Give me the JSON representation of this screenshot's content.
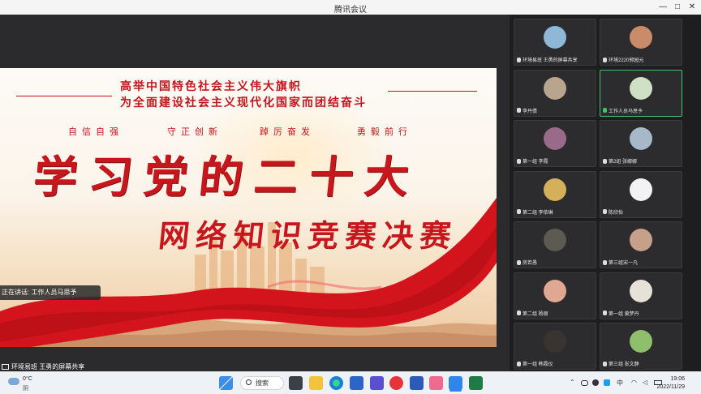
{
  "window": {
    "title": "腾讯会议",
    "min": "—",
    "max": "□",
    "close": "✕"
  },
  "slide": {
    "headline1": "高举中国特色社会主义伟大旗帜",
    "headline2": "为全面建设社会主义现代化国家而团结奋斗",
    "slogans": [
      "自信自强",
      "守正创新",
      "踔厉奋发",
      "勇毅前行"
    ],
    "title": "学习党的二十大",
    "subtitle": "网络知识竞赛决赛"
  },
  "speaking_label": "正在讲话: 工作人员马思予",
  "share_label": "环境易班 王勇的屏幕共享",
  "participants": [
    {
      "name": "环境易班 王勇的屏幕共享",
      "avatar_color": "#8fb8d8",
      "active": false,
      "mic_on": false
    },
    {
      "name": "环境2220郭园元",
      "avatar_color": "#c98b6a",
      "active": false,
      "mic_on": false
    },
    {
      "name": "李丹倩",
      "avatar_color": "#b9a58e",
      "active": false,
      "mic_on": false
    },
    {
      "name": "工作人员马思予",
      "avatar_color": "#cfe0c6",
      "active": true,
      "mic_on": true
    },
    {
      "name": "第一组 李霞",
      "avatar_color": "#9a6a8a",
      "active": false,
      "mic_on": false
    },
    {
      "name": "第2组 张娜娜",
      "avatar_color": "#a7b8c8",
      "active": false,
      "mic_on": false
    },
    {
      "name": "第二组 李依琳",
      "avatar_color": "#d4b05a",
      "active": false,
      "mic_on": false
    },
    {
      "name": "陈欣怡",
      "avatar_color": "#f2f2f2",
      "active": false,
      "mic_on": false
    },
    {
      "name": "房若愚",
      "avatar_color": "#5d5a52",
      "active": false,
      "mic_on": false
    },
    {
      "name": "第三组宋一凡",
      "avatar_color": "#c7a08a",
      "active": false,
      "mic_on": false
    },
    {
      "name": "第二组 杨丽",
      "avatar_color": "#e0a893",
      "active": false,
      "mic_on": false
    },
    {
      "name": "第一组 黄梦丹",
      "avatar_color": "#e6e2d8",
      "active": false,
      "mic_on": false
    },
    {
      "name": "第一组 韩霞仪",
      "avatar_color": "#3a3430",
      "active": false,
      "mic_on": false
    },
    {
      "name": "第三组 张文静",
      "avatar_color": "#8fbf6a",
      "active": false,
      "mic_on": false
    }
  ],
  "taskbar": {
    "weather_temp": "0°C",
    "weather_cond": "阴",
    "search_label": "搜索",
    "ime": "中",
    "time": "19:06",
    "date": "2022/11/29"
  },
  "colors": {
    "accent_red": "#c8161d",
    "active_green": "#3ec46d"
  }
}
